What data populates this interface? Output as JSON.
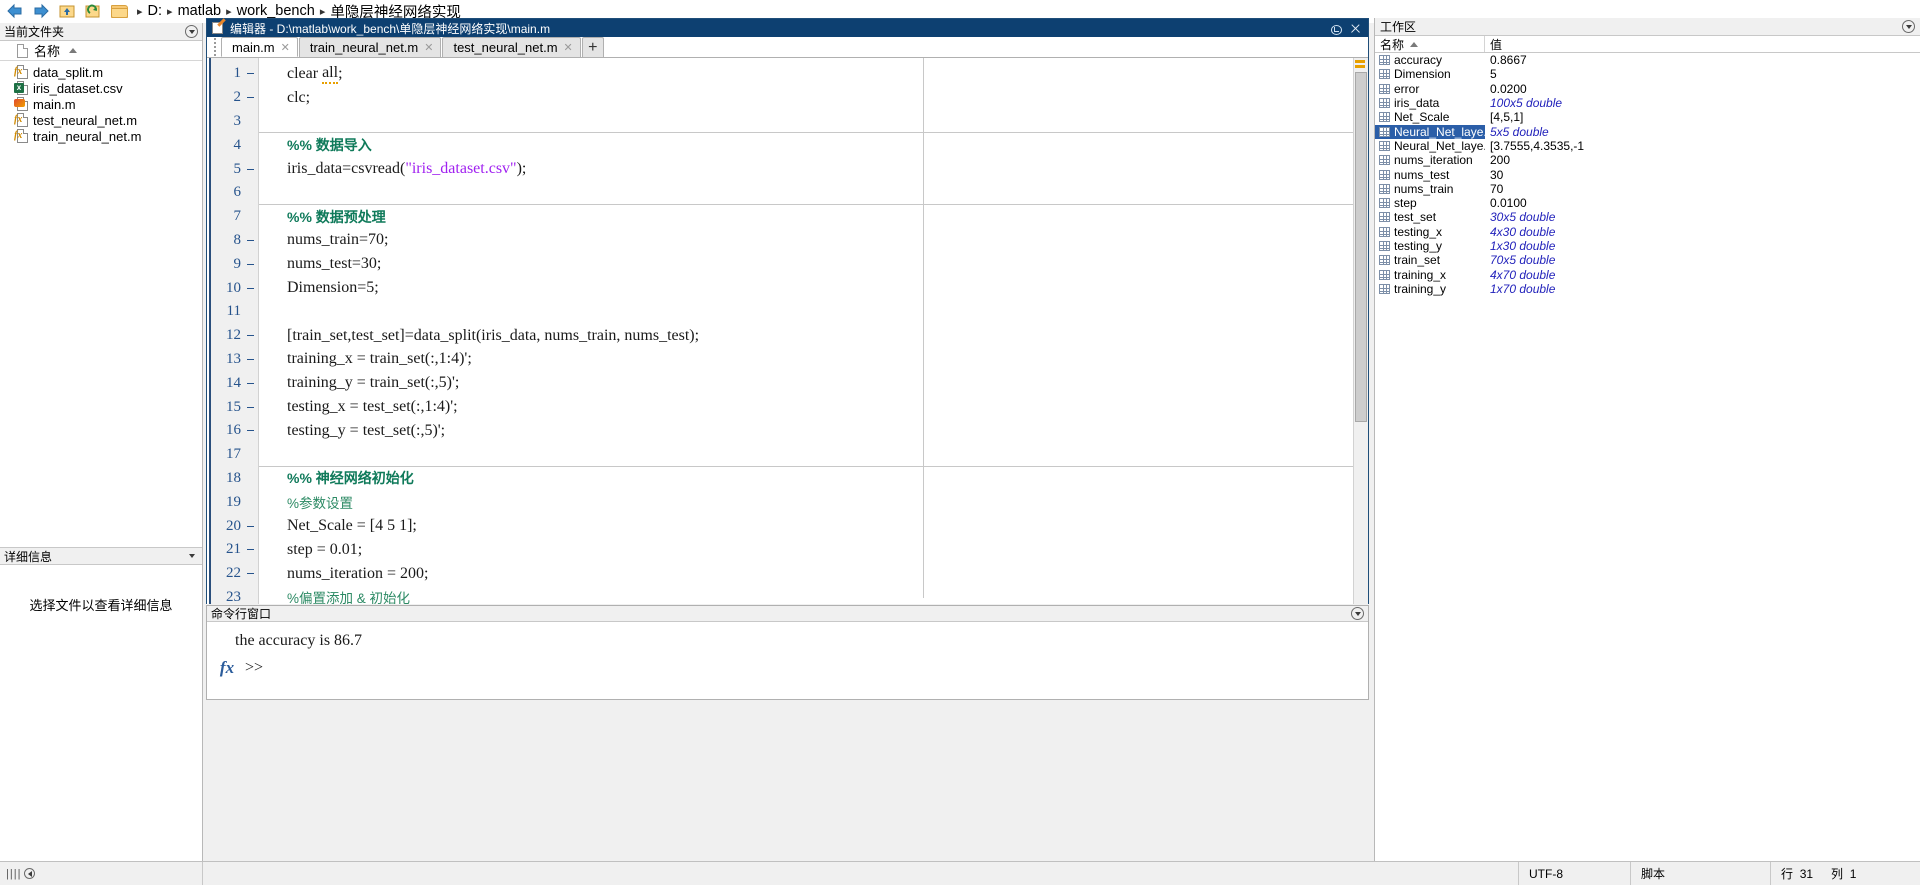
{
  "addressbar": {
    "back_icon": "back-arrow-icon",
    "forward_icon": "forward-arrow-icon",
    "up_icon": "up-folder-icon",
    "refresh_icon": "refresh-icon",
    "folder_icon": "folder-icon",
    "crumbs": [
      "D:",
      "matlab",
      "work_bench",
      "单隐层神经网络实现"
    ],
    "separator": "▸"
  },
  "left_panel": {
    "title": "当前文件夹",
    "collapse_icon": "chevron-down-circle-icon",
    "column_header": "名称",
    "sort_indicator": "sort-ascending-icon",
    "files": [
      {
        "name": "data_split.m",
        "icon": "m-function-file-icon",
        "kind": "fx"
      },
      {
        "name": "iris_dataset.csv",
        "icon": "csv-file-icon",
        "kind": "xa"
      },
      {
        "name": "main.m",
        "icon": "m-script-file-icon",
        "kind": "mm"
      },
      {
        "name": "test_neural_net.m",
        "icon": "m-function-file-icon",
        "kind": "fx"
      },
      {
        "name": "train_neural_net.m",
        "icon": "m-function-file-icon",
        "kind": "fx"
      }
    ],
    "details_title": "详细信息",
    "details_collapse_icon": "chevron-down-icon",
    "details_message": "选择文件以查看详细信息"
  },
  "editor": {
    "icon": "editor-pencil-icon",
    "title": "编辑器 - D:\\matlab\\work_bench\\单隐层神经网络实现\\main.m",
    "undock_icon": "undock-icon",
    "close_icon": "close-icon",
    "tabs": [
      {
        "label": "main.m",
        "active": true,
        "close_icon": "tab-close-icon"
      },
      {
        "label": "train_neural_net.m",
        "active": false,
        "close_icon": "tab-close-icon"
      },
      {
        "label": "test_neural_net.m",
        "active": false,
        "close_icon": "tab-close-icon"
      }
    ],
    "new_tab_label": "+",
    "lines": [
      {
        "n": "1",
        "exec": true,
        "section": false,
        "segments": [
          {
            "t": "clear ",
            "c": ""
          },
          {
            "t": "all",
            "c": "tk-warn"
          },
          {
            "t": ";",
            "c": ""
          }
        ]
      },
      {
        "n": "2",
        "exec": true,
        "section": false,
        "segments": [
          {
            "t": "clc;",
            "c": ""
          }
        ]
      },
      {
        "n": "3",
        "exec": false,
        "section": false,
        "segments": []
      },
      {
        "n": "4",
        "exec": false,
        "section": true,
        "segments": [
          {
            "t": "%% 数据导入",
            "c": "tk-com"
          }
        ]
      },
      {
        "n": "5",
        "exec": true,
        "section": false,
        "segments": [
          {
            "t": "iris_data=csvread(",
            "c": ""
          },
          {
            "t": "\"iris_dataset.csv\"",
            "c": "tk-str"
          },
          {
            "t": ");",
            "c": ""
          }
        ]
      },
      {
        "n": "6",
        "exec": false,
        "section": false,
        "segments": []
      },
      {
        "n": "7",
        "exec": false,
        "section": true,
        "segments": [
          {
            "t": "%% 数据预处理",
            "c": "tk-com"
          }
        ]
      },
      {
        "n": "8",
        "exec": true,
        "section": false,
        "segments": [
          {
            "t": "nums_train=70;",
            "c": ""
          }
        ]
      },
      {
        "n": "9",
        "exec": true,
        "section": false,
        "segments": [
          {
            "t": "nums_test=30;",
            "c": ""
          }
        ]
      },
      {
        "n": "10",
        "exec": true,
        "section": false,
        "segments": [
          {
            "t": "Dimension=5;",
            "c": ""
          }
        ]
      },
      {
        "n": "11",
        "exec": false,
        "section": false,
        "segments": []
      },
      {
        "n": "12",
        "exec": true,
        "section": false,
        "segments": [
          {
            "t": "[train_set,test_set]=data_split(iris_data, nums_train, nums_test);",
            "c": ""
          }
        ]
      },
      {
        "n": "13",
        "exec": true,
        "section": false,
        "segments": [
          {
            "t": "training_x = train_set(:,1:4)';",
            "c": ""
          }
        ]
      },
      {
        "n": "14",
        "exec": true,
        "section": false,
        "segments": [
          {
            "t": "training_y = train_set(:,5)';",
            "c": ""
          }
        ]
      },
      {
        "n": "15",
        "exec": true,
        "section": false,
        "segments": [
          {
            "t": "testing_x = test_set(:,1:4)';",
            "c": ""
          }
        ]
      },
      {
        "n": "16",
        "exec": true,
        "section": false,
        "segments": [
          {
            "t": "testing_y = test_set(:,5)';",
            "c": ""
          }
        ]
      },
      {
        "n": "17",
        "exec": false,
        "section": false,
        "segments": []
      },
      {
        "n": "18",
        "exec": false,
        "section": true,
        "segments": [
          {
            "t": "%% 神经网络初始化",
            "c": "tk-com"
          }
        ]
      },
      {
        "n": "19",
        "exec": false,
        "section": false,
        "segments": [
          {
            "t": "%参数设置",
            "c": "tk-com2"
          }
        ]
      },
      {
        "n": "20",
        "exec": true,
        "section": false,
        "segments": [
          {
            "t": "Net_Scale = [4 5 1];",
            "c": ""
          }
        ]
      },
      {
        "n": "21",
        "exec": true,
        "section": false,
        "segments": [
          {
            "t": "step = 0.01;",
            "c": ""
          }
        ]
      },
      {
        "n": "22",
        "exec": true,
        "section": false,
        "segments": [
          {
            "t": "nums_iteration = 200;",
            "c": ""
          }
        ]
      },
      {
        "n": "23",
        "exec": false,
        "section": false,
        "segments": [
          {
            "t": "%偏置添加 & 初始化",
            "c": "tk-com2"
          }
        ]
      }
    ]
  },
  "command_window": {
    "title": "命令行窗口",
    "collapse_icon": "chevron-down-circle-icon",
    "output": "the accuracy is 86.7",
    "fx_icon": "fx-icon",
    "prompt": ">>"
  },
  "workspace": {
    "title": "工作区",
    "collapse_icon": "chevron-down-circle-icon",
    "columns": [
      "名称",
      "值"
    ],
    "sort_indicator": "sort-ascending-icon",
    "variables": [
      {
        "name": "accuracy",
        "value": "0.8667",
        "italic": false,
        "selected": false,
        "icon": "variable-grid-icon"
      },
      {
        "name": "Dimension",
        "value": "5",
        "italic": false,
        "selected": false,
        "icon": "variable-grid-icon"
      },
      {
        "name": "error",
        "value": "0.0200",
        "italic": false,
        "selected": false,
        "icon": "variable-grid-icon"
      },
      {
        "name": "iris_data",
        "value": "100x5 double",
        "italic": true,
        "selected": false,
        "icon": "variable-grid-icon"
      },
      {
        "name": "Net_Scale",
        "value": "[4,5,1]",
        "italic": false,
        "selected": false,
        "icon": "variable-grid-icon"
      },
      {
        "name": "Neural_Net_laye...",
        "value": "5x5 double",
        "italic": true,
        "selected": true,
        "icon": "variable-grid-icon"
      },
      {
        "name": "Neural_Net_laye...",
        "value": "[3.7555,4.3535,-1",
        "italic": false,
        "selected": false,
        "icon": "variable-grid-icon"
      },
      {
        "name": "nums_iteration",
        "value": "200",
        "italic": false,
        "selected": false,
        "icon": "variable-grid-icon"
      },
      {
        "name": "nums_test",
        "value": "30",
        "italic": false,
        "selected": false,
        "icon": "variable-grid-icon"
      },
      {
        "name": "nums_train",
        "value": "70",
        "italic": false,
        "selected": false,
        "icon": "variable-grid-icon"
      },
      {
        "name": "step",
        "value": "0.0100",
        "italic": false,
        "selected": false,
        "icon": "variable-grid-icon"
      },
      {
        "name": "test_set",
        "value": "30x5 double",
        "italic": true,
        "selected": false,
        "icon": "variable-grid-icon"
      },
      {
        "name": "testing_x",
        "value": "4x30 double",
        "italic": true,
        "selected": false,
        "icon": "variable-grid-icon"
      },
      {
        "name": "testing_y",
        "value": "1x30 double",
        "italic": true,
        "selected": false,
        "icon": "variable-grid-icon"
      },
      {
        "name": "train_set",
        "value": "70x5 double",
        "italic": true,
        "selected": false,
        "icon": "variable-grid-icon"
      },
      {
        "name": "training_x",
        "value": "4x70 double",
        "italic": true,
        "selected": false,
        "icon": "variable-grid-icon"
      },
      {
        "name": "training_y",
        "value": "1x70 double",
        "italic": true,
        "selected": false,
        "icon": "variable-grid-icon"
      }
    ]
  },
  "statusbar": {
    "busy_dots": "||||",
    "encoding": "UTF-8",
    "filetype": "脚本",
    "row_label": "行",
    "row_value": "31",
    "col_label": "列",
    "col_value": "1"
  },
  "colors": {
    "titlebar": "#0d4071",
    "selection": "#2b5ea8",
    "comment": "#0f7a5a",
    "string": "#a020f0",
    "gutter_number": "#26538c"
  }
}
